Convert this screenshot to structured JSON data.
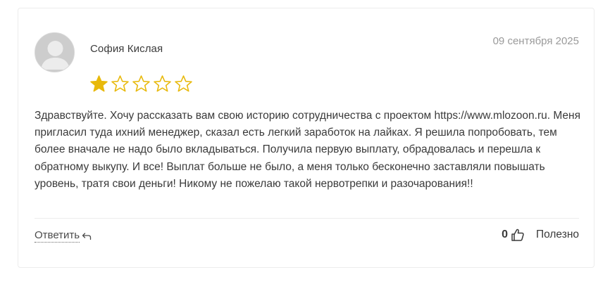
{
  "review": {
    "author": "София Кислая",
    "date": "09 сентября 2025",
    "rating": 1,
    "rating_max": 5,
    "text": "Здравствуйте. Хочу рассказать вам свою историю сотрудничества с проектом https://www.mlozoon.ru. Меня пригласил туда ихний менеджер, сказал есть легкий заработок на лайках. Я решила попробовать, тем более вначале не надо было вкладываться. Получила первую выплату, обрадовалась и перешла к обратному выкупу. И все! Выплат больше не было, а меня только бесконечно заставляли повышать уровень, тратя свои деньги! Никому не пожелаю такой нервотрепки и разочарования!!",
    "reply_label": "Ответить",
    "helpful_count": "0",
    "helpful_label": "Полезно"
  },
  "icons": {
    "avatar": "user-silhouette-icon",
    "star_filled": "star-filled-icon",
    "star_empty": "star-outline-icon",
    "reply": "reply-arrow-icon",
    "thumb": "thumbs-up-icon"
  },
  "colors": {
    "star": "#e8b90c",
    "text": "#3a3a3a",
    "date": "#9a9a9a",
    "border": "#ececec"
  }
}
